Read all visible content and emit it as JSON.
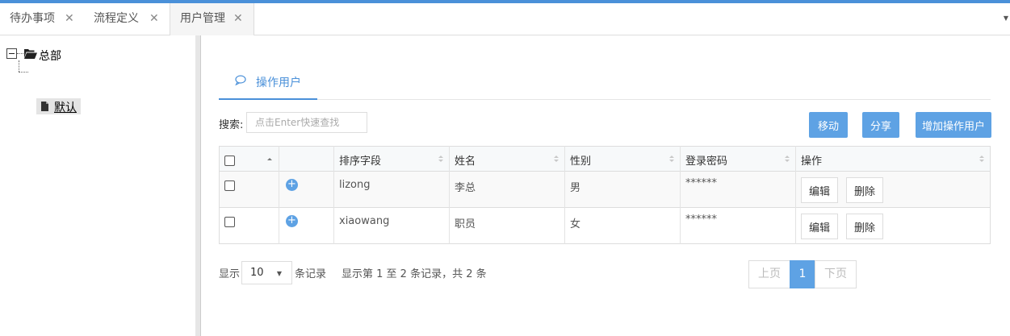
{
  "tabs": [
    {
      "label": "待办事项",
      "close": "✕"
    },
    {
      "label": "流程定义",
      "close": "✕"
    },
    {
      "label": "用户管理",
      "close": "✕",
      "active": true
    }
  ],
  "tab_menu_icon": "caret-down-icon",
  "tree": {
    "root_label": "总部",
    "child_label": "默认"
  },
  "sub_tab": {
    "label": "操作用户",
    "icon": "chat-bubble-icon"
  },
  "search": {
    "label": "搜索:",
    "placeholder": "点击Enter快速查找",
    "value": ""
  },
  "buttons": {
    "move": "移动",
    "share": "分享",
    "add": "增加操作用户"
  },
  "table": {
    "columns": [
      "排序字段",
      "姓名",
      "性别",
      "登录密码",
      "操作"
    ],
    "rows": [
      {
        "sort_field": "lizong",
        "name": "李总",
        "gender": "男",
        "password": "******",
        "edit": "编辑",
        "delete": "删除"
      },
      {
        "sort_field": "xiaowang",
        "name": "职员",
        "gender": "女",
        "password": "******",
        "edit": "编辑",
        "delete": "删除"
      }
    ]
  },
  "footer": {
    "show_label": "显示",
    "page_size": "10",
    "page_size_suffix": "条记录",
    "info": "显示第 1 至 2 条记录，共 2 条"
  },
  "pagination": {
    "prev": "上页",
    "current": "1",
    "next": "下页"
  },
  "colors": {
    "accent": "#5ea2e4",
    "topbar": "#4a90d9"
  }
}
